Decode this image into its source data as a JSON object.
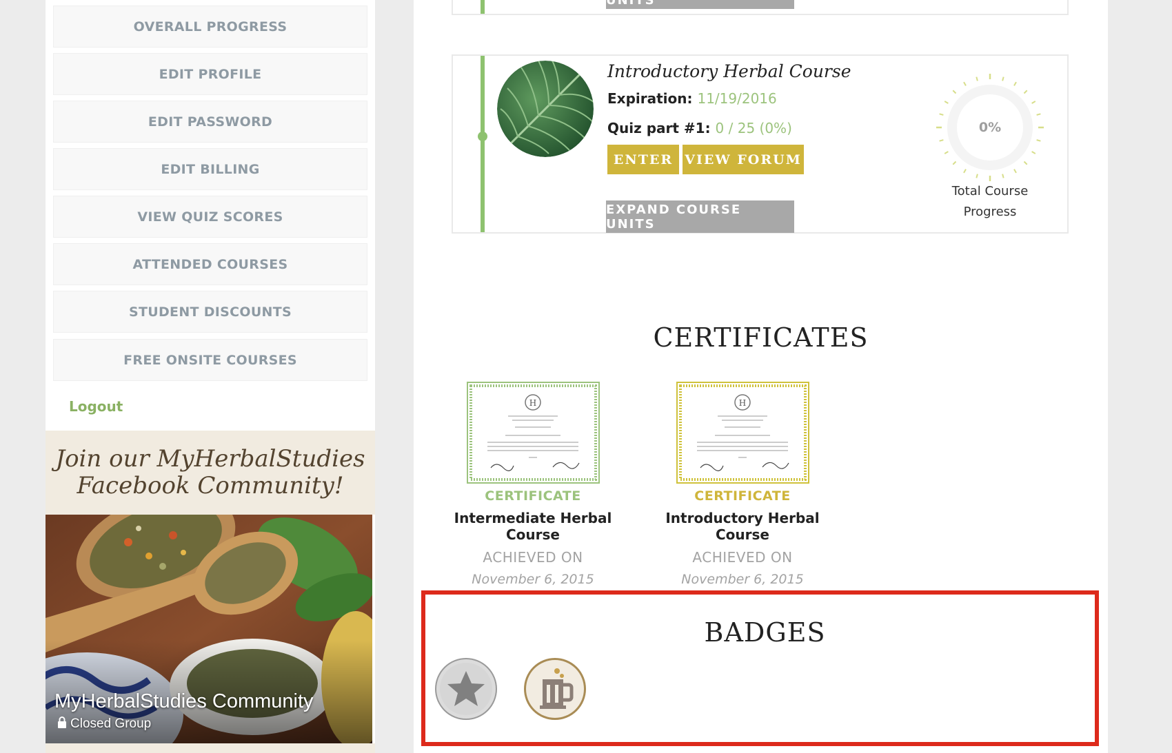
{
  "sidebar": {
    "menu": [
      {
        "label": "OVERALL PROGRESS"
      },
      {
        "label": "EDIT PROFILE"
      },
      {
        "label": "EDIT PASSWORD"
      },
      {
        "label": "EDIT BILLING"
      },
      {
        "label": "VIEW QUIZ SCORES"
      },
      {
        "label": "ATTENDED COURSES"
      },
      {
        "label": "STUDENT DISCOUNTS"
      },
      {
        "label": "FREE ONSITE COURSES"
      }
    ],
    "logout_label": "Logout",
    "facebook_promo": {
      "heading_line1": "Join our MyHerbalStudies",
      "heading_line2": "Facebook Community!",
      "group_name": "MyHerbalStudies Community",
      "group_type": "Closed Group"
    }
  },
  "prev_course": {
    "expand_label": "EXPAND COURSE UNITS"
  },
  "course": {
    "title": "Introductory Herbal Course",
    "expiration_label": "Expiration:",
    "expiration_value": "11/19/2016",
    "quiz_label": "Quiz part #1:",
    "quiz_value": "0 / 25 (0%)",
    "enter_label": "ENTER",
    "forum_label": "VIEW FORUM",
    "expand_label": "EXPAND COURSE UNITS",
    "progress_percent": "0%",
    "progress_value": 0,
    "progress_label_line1": "Total Course",
    "progress_label_line2": "Progress"
  },
  "certificates": {
    "heading": "CERTIFICATES",
    "items": [
      {
        "type": "CERTIFICATE",
        "course": "Intermediate Herbal Course",
        "achieved_label": "ACHIEVED ON",
        "date": "November 6, 2015",
        "color": "#9cc37d"
      },
      {
        "type": "CERTIFICATE",
        "course": "Introductory Herbal Course",
        "achieved_label": "ACHIEVED ON",
        "date": "November 6, 2015",
        "color": "#cfb53b"
      }
    ]
  },
  "badges": {
    "heading": "BADGES",
    "items": [
      {
        "icon": "star-icon"
      },
      {
        "icon": "tea-mug-icon"
      }
    ]
  },
  "colors": {
    "green_accent": "#8ec26f",
    "gold_accent": "#cfb53b",
    "highlight_border": "#dd2a1b",
    "menu_text": "#8e9aa3"
  }
}
